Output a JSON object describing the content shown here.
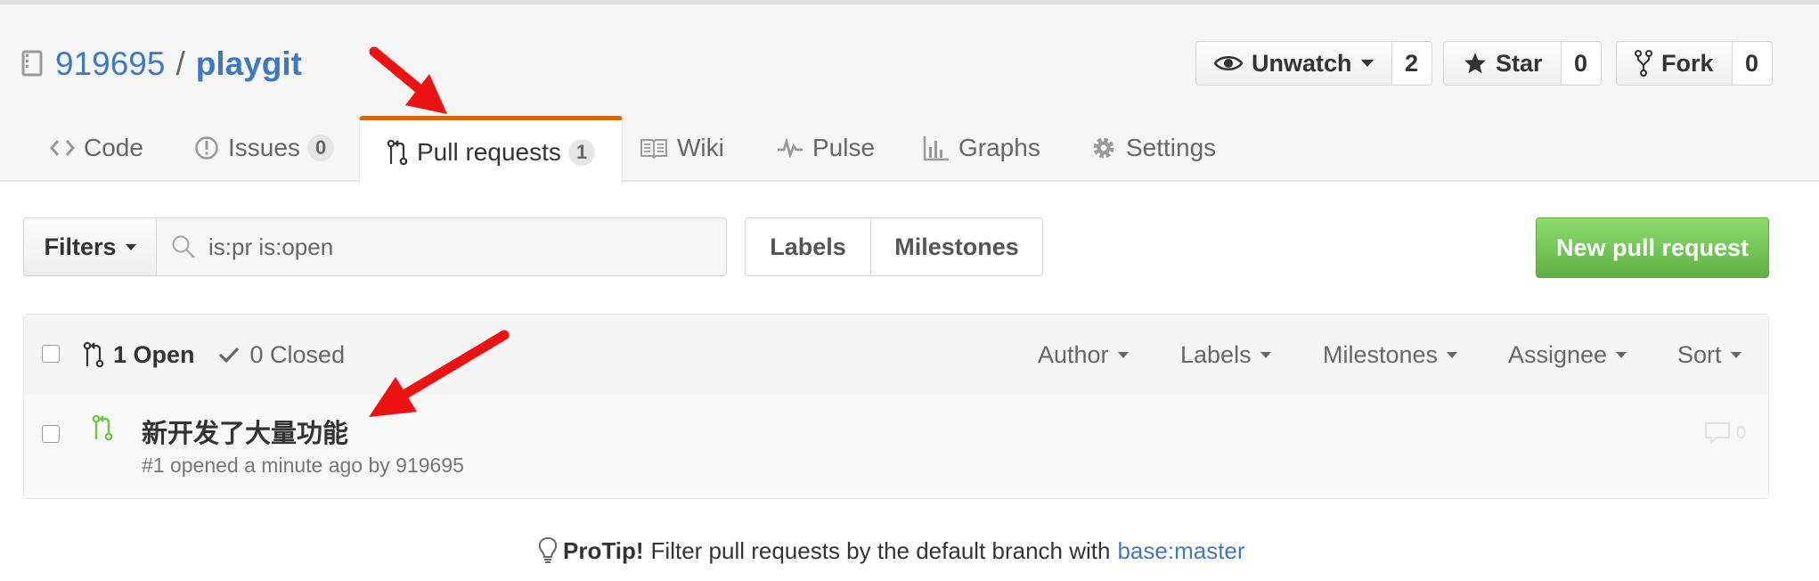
{
  "repo": {
    "owner": "919695",
    "separator": "/",
    "name": "playgit"
  },
  "actions": {
    "watch": {
      "label": "Unwatch",
      "count": "2"
    },
    "star": {
      "label": "Star",
      "count": "0"
    },
    "fork": {
      "label": "Fork",
      "count": "0"
    }
  },
  "tabs": [
    {
      "label": "Code",
      "icon": "code-icon"
    },
    {
      "label": "Issues",
      "counter": "0",
      "icon": "issue-icon"
    },
    {
      "label": "Pull requests",
      "counter": "1",
      "icon": "pull-request-icon",
      "active": true
    },
    {
      "label": "Wiki",
      "icon": "book-icon"
    },
    {
      "label": "Pulse",
      "icon": "pulse-icon"
    },
    {
      "label": "Graphs",
      "icon": "graph-icon"
    },
    {
      "label": "Settings",
      "icon": "gear-icon"
    }
  ],
  "toolbar": {
    "filters_label": "Filters",
    "search_value": "is:pr is:open",
    "labels_label": "Labels",
    "milestones_label": "Milestones",
    "new_pr_label": "New pull request"
  },
  "list_header": {
    "open_label": "1 Open",
    "closed_label": "0 Closed",
    "filters": [
      "Author",
      "Labels",
      "Milestones",
      "Assignee",
      "Sort"
    ]
  },
  "pull_requests": [
    {
      "title": "新开发了大量功能",
      "meta": "#1 opened a minute ago by 919695",
      "comments": "0"
    }
  ],
  "protip": {
    "lead": "ProTip!",
    "text": "Filter pull requests by the default branch with",
    "link": "base:master"
  },
  "colors": {
    "link": "#4078c0",
    "active_tab_border": "#d26911",
    "primary_button": "#60b044",
    "annotation_arrow": "#ff0000"
  }
}
